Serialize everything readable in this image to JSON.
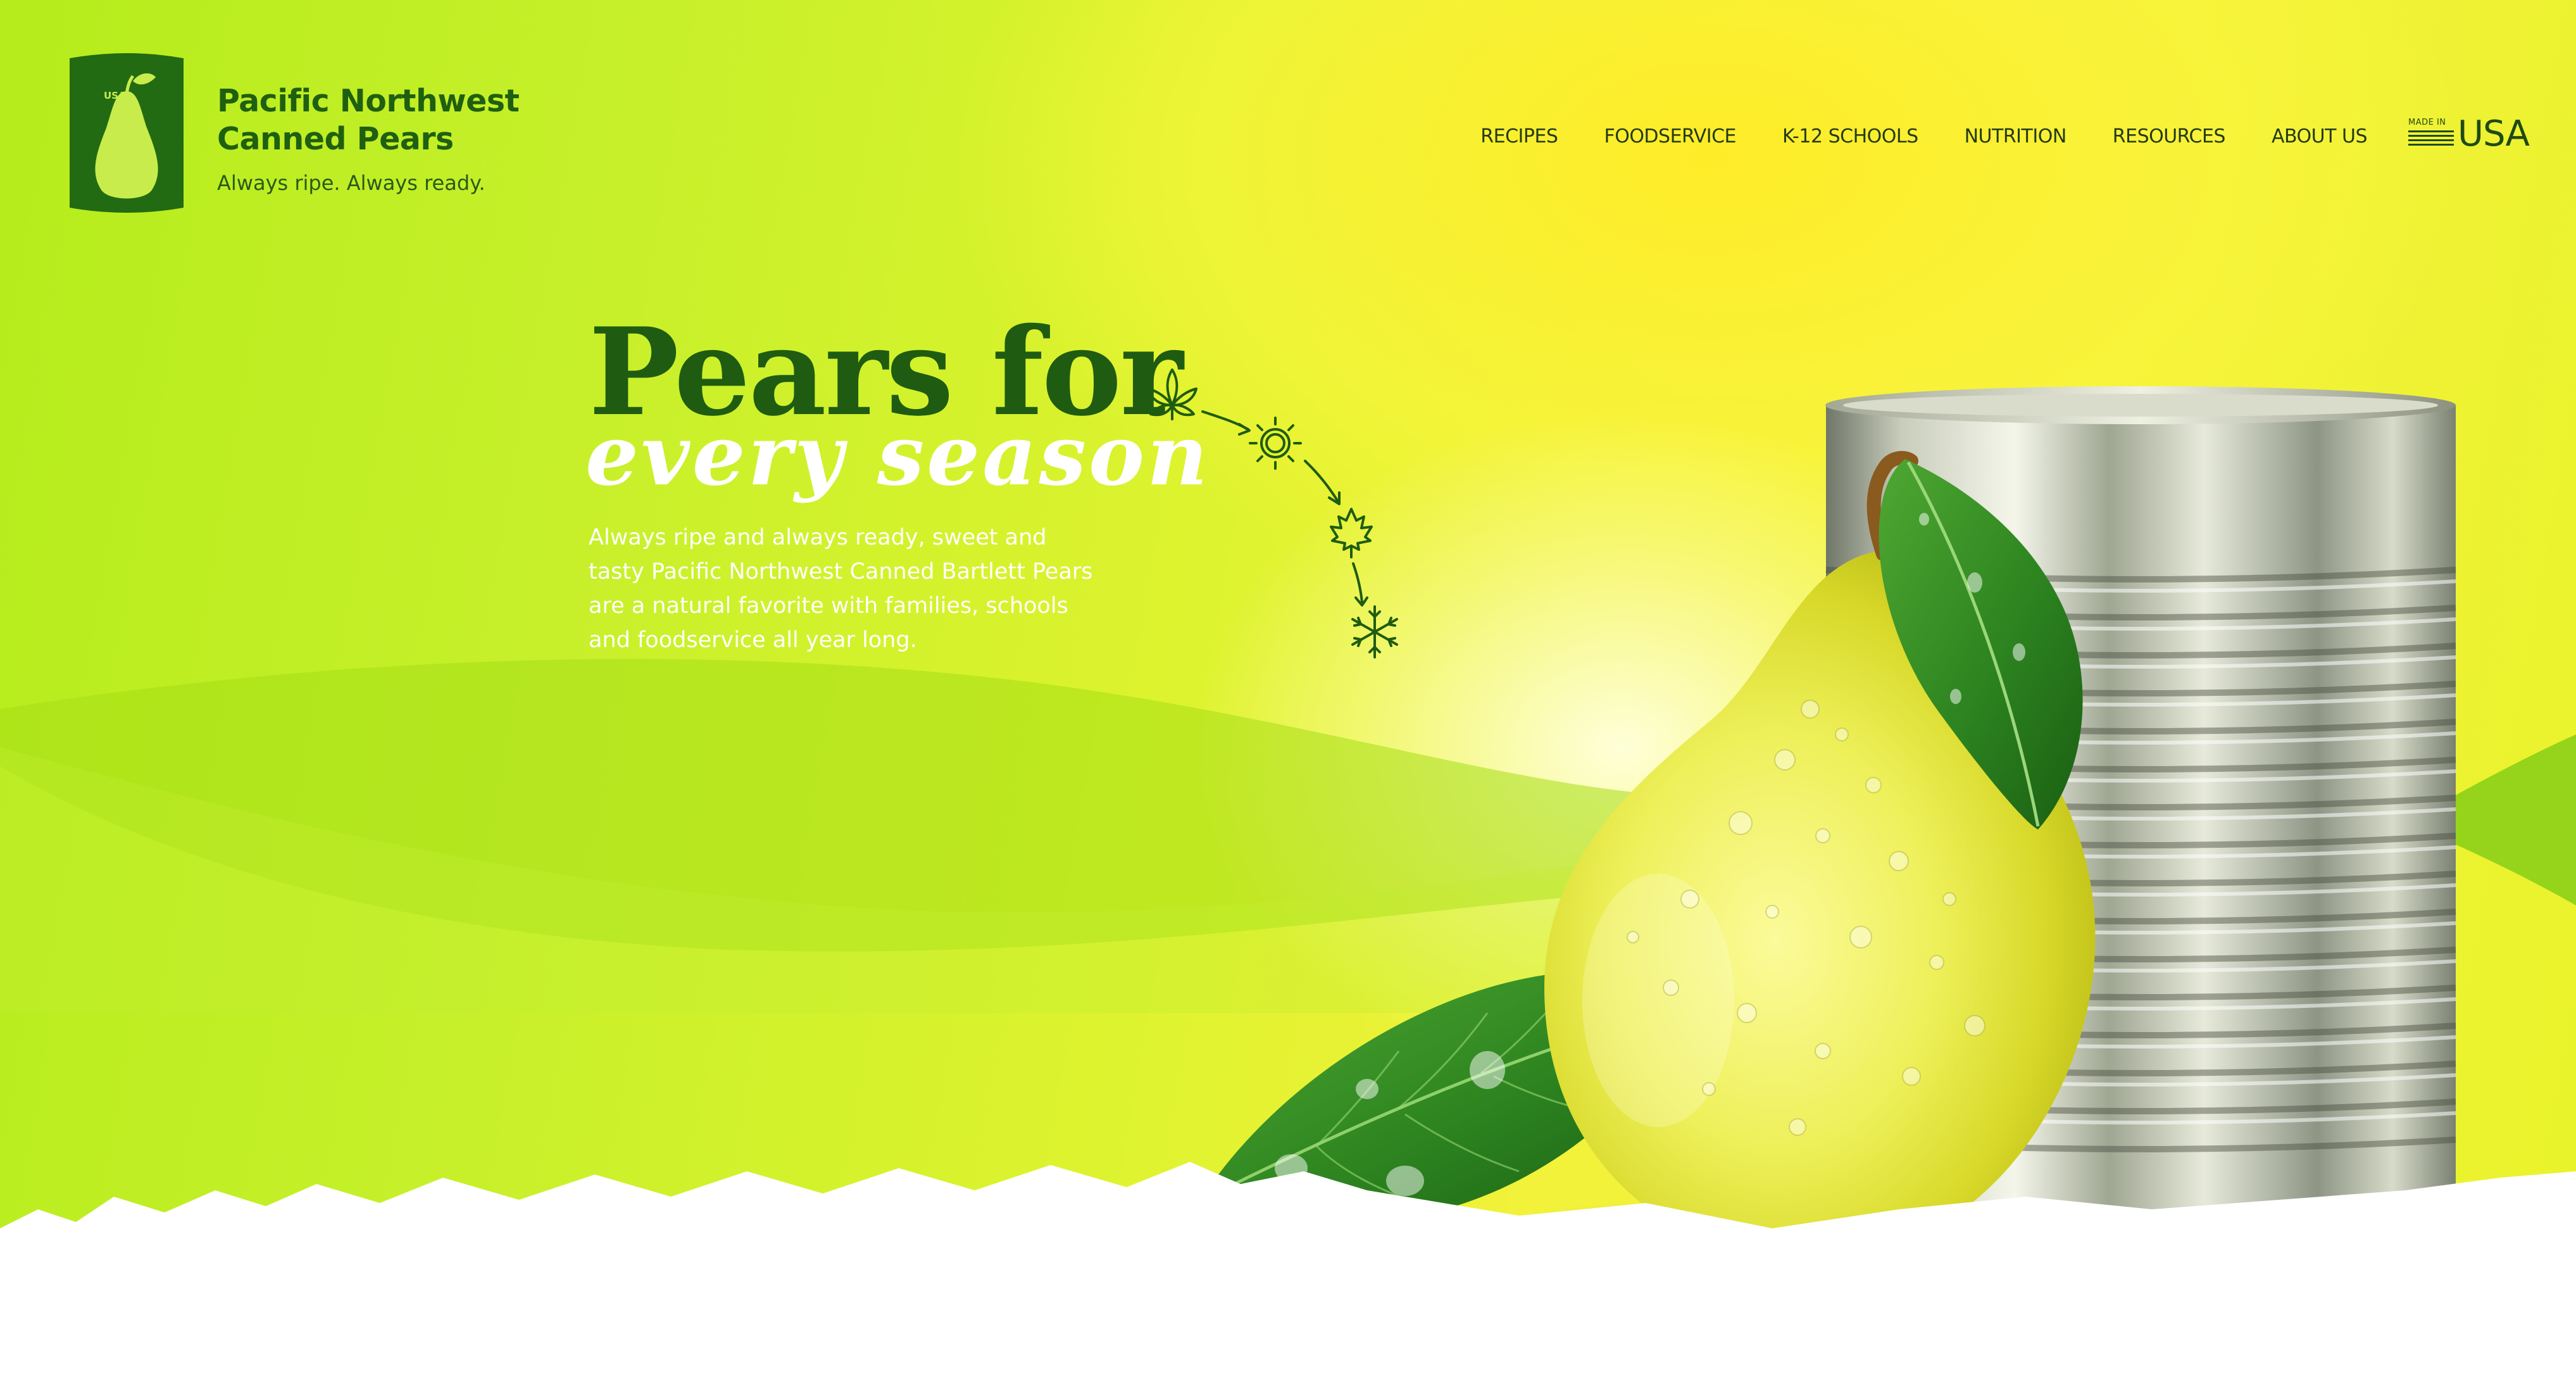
{
  "brand": {
    "can_badge": "USA",
    "name_line1": "Pacific Northwest",
    "name_line2": "Canned Pears",
    "tagline": "Always ripe. Always ready."
  },
  "nav": {
    "items": [
      {
        "label": "RECIPES"
      },
      {
        "label": "FOODSERVICE"
      },
      {
        "label": "K-12 SCHOOLS"
      },
      {
        "label": "NUTRITION"
      },
      {
        "label": "RESOURCES"
      },
      {
        "label": "ABOUT US"
      }
    ],
    "made_in_small": "MADE IN",
    "made_in_big": "USA"
  },
  "hero": {
    "title": "Pears for",
    "subtitle": "every  season",
    "description": "Always ripe and always ready, sweet and tasty Pacific Northwest Canned Bartlett Pears are a natural favorite with families, schools and foodservice all year long."
  },
  "seasons": {
    "icons": [
      "leaf-icon",
      "sun-icon",
      "maple-leaf-icon",
      "snowflake-icon"
    ]
  },
  "colors": {
    "brand_green": "#1f5f10",
    "dark_green": "#1f4a14",
    "lime_bg": "#c6f02a",
    "yellow_bg": "#f4f23a",
    "white": "#ffffff"
  }
}
